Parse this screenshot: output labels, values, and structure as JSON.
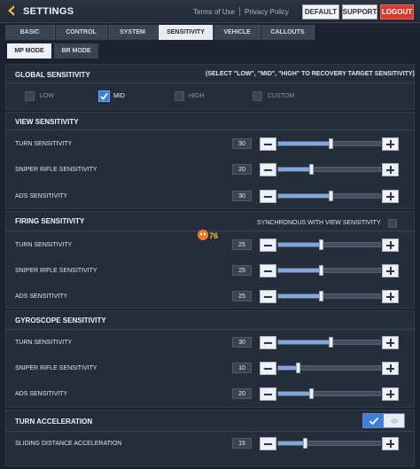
{
  "header": {
    "title": "SETTINGS",
    "links": [
      "Terms of Use",
      "Privacy Policy"
    ],
    "buttons": [
      "DEFAULT",
      "SUPPORT",
      "LOGOUT"
    ]
  },
  "tabs": [
    "BASIC",
    "CONTROL",
    "SYSTEM",
    "SENSITIVITY",
    "VEHICLE",
    "CALLOUTS"
  ],
  "active_tab": "SENSITIVITY",
  "modes": [
    "MP MODE",
    "BR MODE"
  ],
  "active_mode": "MP MODE",
  "global": {
    "title": "GLOBAL SENSITIVITY",
    "note": "(SELECT \"LOW\", \"MID\", \"HIGH\" TO RECOVERY TARGET SENSITIVITY)",
    "options": [
      "LOW",
      "MID",
      "HIGH",
      "CUSTOM"
    ],
    "selected": "MID"
  },
  "view": {
    "title": "VIEW SENSITIVITY",
    "rows": [
      {
        "label": "TURN SENSITIVITY",
        "value": "30",
        "level": 0.52
      },
      {
        "label": "SNIPER RIFLE SENSITIVITY",
        "value": "20",
        "level": 0.33
      },
      {
        "label": "ADS SENSITIVITY",
        "value": "30",
        "level": 0.52
      }
    ]
  },
  "firing": {
    "title": "FIRING SENSITIVITY",
    "sync_label": "SYNCHRONOUS WITH VIEW SENSITIVITY",
    "rows": [
      {
        "label": "TURN SENSITIVITY",
        "value": "25",
        "level": 0.43
      },
      {
        "label": "SNIPER RIFLE SENSITIVITY",
        "value": "25",
        "level": 0.43
      },
      {
        "label": "ADS SENSITIVITY",
        "value": "25",
        "level": 0.43
      }
    ]
  },
  "gyro": {
    "title": "GYROSCOPE SENSITIVITY",
    "rows": [
      {
        "label": "TURN SENSITIVITY",
        "value": "30",
        "level": 0.52
      },
      {
        "label": "SNIPER RIFLE SENSITIVITY",
        "value": "10",
        "level": 0.2
      },
      {
        "label": "ADS SENSITIVITY",
        "value": "20",
        "level": 0.33
      }
    ]
  },
  "accel": {
    "title": "TURN ACCELERATION",
    "toggle_on": true,
    "row": {
      "label": "SLIDING DISTANCE ACCELERATION",
      "value": "15",
      "level": 0.27
    }
  },
  "sticker_text": "76",
  "colors": {
    "accent": "#3d7fd9",
    "logout": "#d83a2e",
    "gold": "#f2c230"
  }
}
